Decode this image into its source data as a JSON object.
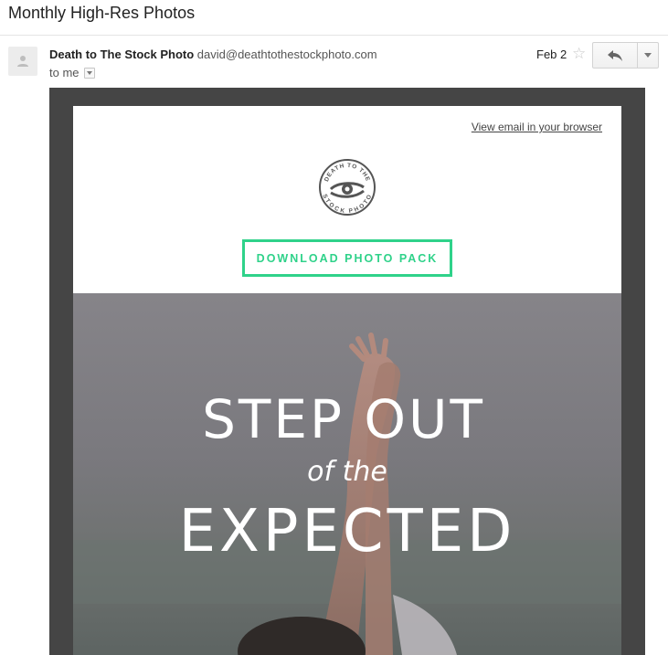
{
  "email": {
    "subject": "Monthly High-Res Photos",
    "sender_name": "Death to The Stock Photo",
    "sender_email": "david@deathtothestockphoto.com",
    "recipient": "to me",
    "date": "Feb 2"
  },
  "toolbar": {
    "star_icon": "star-icon",
    "reply_icon": "reply-icon",
    "more_icon": "chevron-down-icon"
  },
  "content": {
    "view_in_browser": "View email in your browser",
    "logo_text_top": "DEATH TO THE",
    "logo_text_bottom": "STOCK PHOTO",
    "cta_label": "DOWNLOAD PHOTO PACK",
    "hero_line1": "STEP OUT",
    "hero_line2": "of the",
    "hero_line3": "EXPECTED"
  },
  "colors": {
    "accent_green": "#2fd28a",
    "frame_dark": "#454545"
  }
}
